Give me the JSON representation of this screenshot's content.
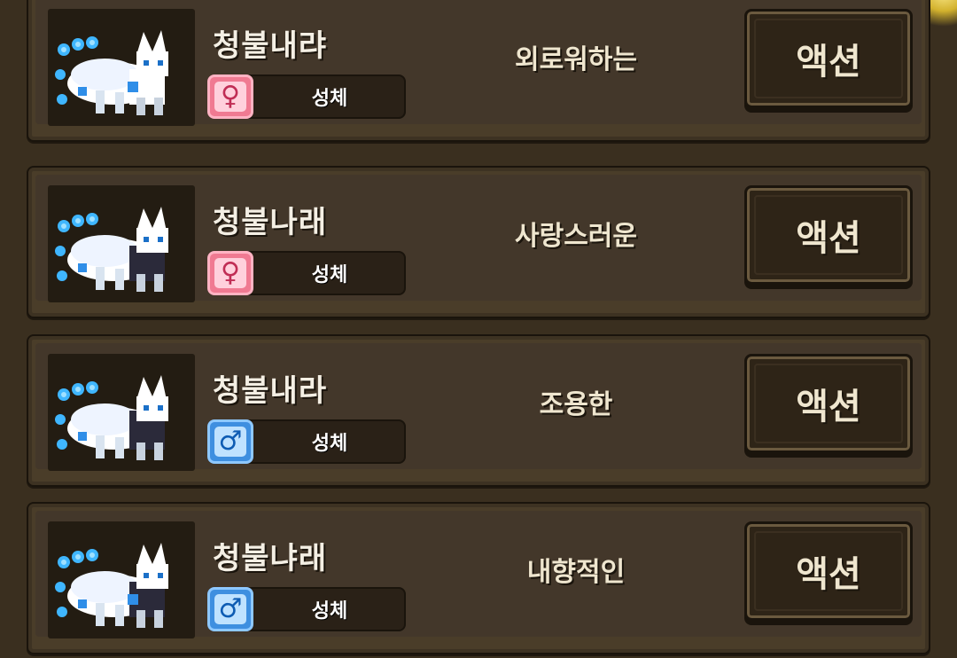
{
  "pets": [
    {
      "name": "청불내랴",
      "gender": "female",
      "gender_symbol": "♀",
      "stage": "성체",
      "personality": "외로워하는",
      "action_label": "액션"
    },
    {
      "name": "청불나래",
      "gender": "female",
      "gender_symbol": "♀",
      "stage": "성체",
      "personality": "사랑스러운",
      "action_label": "액션"
    },
    {
      "name": "청불내라",
      "gender": "male",
      "gender_symbol": "♂",
      "stage": "성체",
      "personality": "조용한",
      "action_label": "액션"
    },
    {
      "name": "청불냐래",
      "gender": "male",
      "gender_symbol": "♂",
      "stage": "성체",
      "personality": "내향적인",
      "action_label": "액션"
    }
  ],
  "colors": {
    "background": "#3a2f1f",
    "card": "#4a3d29",
    "female_badge": "#f07a92",
    "male_badge": "#3e8fe0",
    "flame_blue": "#3fb6ff"
  },
  "icons": {
    "female": "female-symbol-icon",
    "male": "male-symbol-icon",
    "pet": "blue-flame-fox-sprite"
  }
}
